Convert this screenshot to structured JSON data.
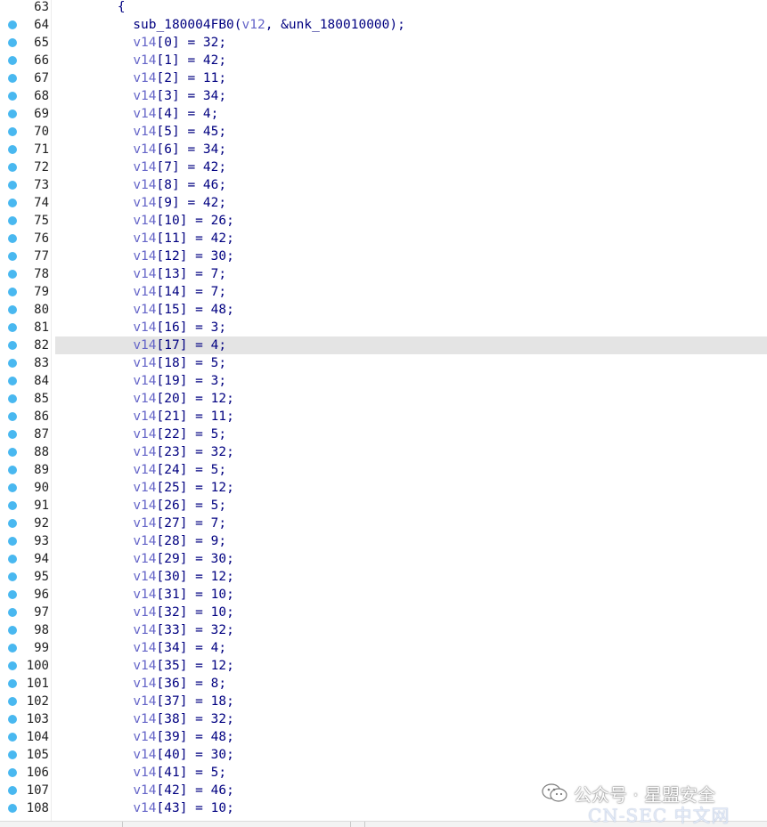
{
  "lines": [
    {
      "num": "63",
      "bp": false,
      "parts": [
        {
          "t": "        {",
          "c": "punct"
        }
      ]
    },
    {
      "num": "64",
      "bp": true,
      "parts": [
        {
          "t": "          sub_180004FB0(",
          "c": "punct"
        },
        {
          "t": "v12",
          "c": "var"
        },
        {
          "t": ", &unk_180010000);",
          "c": "punct"
        }
      ]
    },
    {
      "num": "65",
      "bp": true,
      "idx": "0",
      "val": "32"
    },
    {
      "num": "66",
      "bp": true,
      "idx": "1",
      "val": "42"
    },
    {
      "num": "67",
      "bp": true,
      "idx": "2",
      "val": "11"
    },
    {
      "num": "68",
      "bp": true,
      "idx": "3",
      "val": "34"
    },
    {
      "num": "69",
      "bp": true,
      "idx": "4",
      "val": "4"
    },
    {
      "num": "70",
      "bp": true,
      "idx": "5",
      "val": "45"
    },
    {
      "num": "71",
      "bp": true,
      "idx": "6",
      "val": "34"
    },
    {
      "num": "72",
      "bp": true,
      "idx": "7",
      "val": "42"
    },
    {
      "num": "73",
      "bp": true,
      "idx": "8",
      "val": "46"
    },
    {
      "num": "74",
      "bp": true,
      "idx": "9",
      "val": "42"
    },
    {
      "num": "75",
      "bp": true,
      "idx": "10",
      "val": "26"
    },
    {
      "num": "76",
      "bp": true,
      "idx": "11",
      "val": "42"
    },
    {
      "num": "77",
      "bp": true,
      "idx": "12",
      "val": "30"
    },
    {
      "num": "78",
      "bp": true,
      "idx": "13",
      "val": "7"
    },
    {
      "num": "79",
      "bp": true,
      "idx": "14",
      "val": "7"
    },
    {
      "num": "80",
      "bp": true,
      "idx": "15",
      "val": "48"
    },
    {
      "num": "81",
      "bp": true,
      "idx": "16",
      "val": "3"
    },
    {
      "num": "82",
      "bp": true,
      "idx": "17",
      "val": "4",
      "current": true
    },
    {
      "num": "83",
      "bp": true,
      "idx": "18",
      "val": "5"
    },
    {
      "num": "84",
      "bp": true,
      "idx": "19",
      "val": "3"
    },
    {
      "num": "85",
      "bp": true,
      "idx": "20",
      "val": "12"
    },
    {
      "num": "86",
      "bp": true,
      "idx": "21",
      "val": "11"
    },
    {
      "num": "87",
      "bp": true,
      "idx": "22",
      "val": "5"
    },
    {
      "num": "88",
      "bp": true,
      "idx": "23",
      "val": "32"
    },
    {
      "num": "89",
      "bp": true,
      "idx": "24",
      "val": "5"
    },
    {
      "num": "90",
      "bp": true,
      "idx": "25",
      "val": "12"
    },
    {
      "num": "91",
      "bp": true,
      "idx": "26",
      "val": "5"
    },
    {
      "num": "92",
      "bp": true,
      "idx": "27",
      "val": "7"
    },
    {
      "num": "93",
      "bp": true,
      "idx": "28",
      "val": "9"
    },
    {
      "num": "94",
      "bp": true,
      "idx": "29",
      "val": "30"
    },
    {
      "num": "95",
      "bp": true,
      "idx": "30",
      "val": "12"
    },
    {
      "num": "96",
      "bp": true,
      "idx": "31",
      "val": "10"
    },
    {
      "num": "97",
      "bp": true,
      "idx": "32",
      "val": "10"
    },
    {
      "num": "98",
      "bp": true,
      "idx": "33",
      "val": "32"
    },
    {
      "num": "99",
      "bp": true,
      "idx": "34",
      "val": "4"
    },
    {
      "num": "100",
      "bp": true,
      "idx": "35",
      "val": "12"
    },
    {
      "num": "101",
      "bp": true,
      "idx": "36",
      "val": "8"
    },
    {
      "num": "102",
      "bp": true,
      "idx": "37",
      "val": "18"
    },
    {
      "num": "103",
      "bp": true,
      "idx": "38",
      "val": "32"
    },
    {
      "num": "104",
      "bp": true,
      "idx": "39",
      "val": "48"
    },
    {
      "num": "105",
      "bp": true,
      "idx": "40",
      "val": "30"
    },
    {
      "num": "106",
      "bp": true,
      "idx": "41",
      "val": "5"
    },
    {
      "num": "107",
      "bp": true,
      "idx": "42",
      "val": "46"
    },
    {
      "num": "108",
      "bp": true,
      "idx": "43",
      "val": "10"
    }
  ],
  "array_name": "v14",
  "colors": {
    "code_text": "#000080",
    "variable": "#6464c8",
    "breakpoint_dot": "#49b8f0",
    "current_line_bg": "#e4e4e4"
  },
  "watermark": {
    "account": "公众号 · 星盟安全",
    "site": "CN-SEC 中文网",
    "icon": "wechat-icon"
  }
}
